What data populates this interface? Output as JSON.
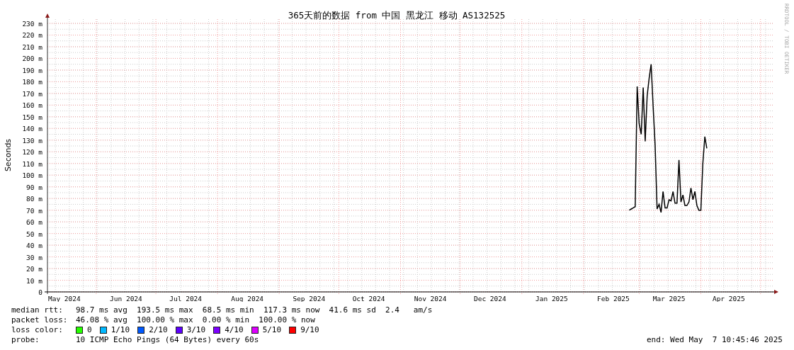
{
  "chart": {
    "title": "365天前的数据 from 中国 黑龙江 移动 AS132525",
    "credit": "RRDTOOL / TOBI OETIKER",
    "chart_data": {
      "type": "line",
      "grid": true,
      "ylabel": "Seconds",
      "ylim": [
        0,
        230
      ],
      "categories": [
        null,
        null,
        null,
        null,
        null,
        null,
        null,
        null,
        "May 2024",
        null,
        null,
        null,
        null,
        null,
        null,
        null,
        null,
        null,
        null,
        null,
        null,
        null,
        null,
        null,
        null,
        null,
        null,
        null,
        null,
        null,
        null,
        null,
        null,
        null,
        null,
        null,
        null,
        null,
        null,
        "Jun 2024",
        null,
        null,
        null,
        null,
        null,
        null,
        null,
        null,
        null,
        null,
        null,
        null,
        null,
        null,
        null,
        null,
        null,
        null,
        null,
        null,
        null,
        null,
        null,
        null,
        null,
        null,
        null,
        null,
        null,
        "Jul 2024",
        null,
        null,
        null,
        null,
        null,
        null,
        null,
        null,
        null,
        null,
        null,
        null,
        null,
        null,
        null,
        null,
        null,
        null,
        null,
        null,
        null,
        null,
        null,
        null,
        null,
        null,
        null,
        null,
        null,
        null,
        "Aug 2024",
        null,
        null,
        null,
        null,
        null,
        null,
        null,
        null,
        null,
        null,
        null,
        null,
        null,
        null,
        null,
        null,
        null,
        null,
        null,
        null,
        null,
        null,
        null,
        null,
        null,
        null,
        null,
        null,
        null,
        null,
        "Sep 2024",
        null,
        null,
        null,
        null,
        null,
        null,
        null,
        null,
        null,
        null,
        null,
        null,
        null,
        null,
        null,
        null,
        null,
        null,
        null,
        null,
        null,
        null,
        null,
        null,
        null,
        null,
        null,
        null,
        null,
        "Oct 2024",
        null,
        null,
        null,
        null,
        null,
        null,
        null,
        null,
        null,
        null,
        null,
        null,
        null,
        null,
        null,
        null,
        null,
        null,
        null,
        null,
        null,
        null,
        null,
        null,
        null,
        null,
        null,
        null,
        null,
        null,
        "Nov 2024",
        null,
        null,
        null,
        null,
        null,
        null,
        null,
        null,
        null,
        null,
        null,
        null,
        null,
        null,
        null,
        null,
        null,
        null,
        null,
        null,
        null,
        null,
        null,
        null,
        null,
        null,
        null,
        null,
        null,
        "Dec 2024",
        null,
        null,
        null,
        null,
        null,
        null,
        null,
        null,
        null,
        null,
        null,
        null,
        null,
        null,
        null,
        null,
        null,
        null,
        null,
        null,
        null,
        null,
        null,
        null,
        null,
        null,
        null,
        null,
        null,
        null,
        "Jan 2025",
        null,
        null,
        null,
        null,
        null,
        null,
        null,
        null,
        null,
        null,
        null,
        null,
        null,
        null,
        null,
        null,
        null,
        null,
        null,
        null,
        null,
        null,
        null,
        null,
        null,
        null,
        null,
        null,
        null,
        null,
        "Feb 2025",
        null,
        null,
        null,
        null,
        null,
        null,
        null,
        null,
        null,
        null,
        null,
        null,
        null,
        null,
        null,
        null,
        null,
        null,
        null,
        null,
        null,
        null,
        null,
        null,
        null,
        null,
        null,
        "Mar 2025",
        null,
        null,
        null,
        null,
        null,
        null,
        null,
        null,
        null,
        null,
        null,
        null,
        null,
        null,
        null,
        null,
        null,
        null,
        null,
        null,
        null,
        null,
        null,
        null,
        null,
        null,
        null,
        null,
        null,
        "Apr 2025",
        null,
        null,
        null,
        null,
        null,
        null,
        null,
        null,
        null,
        null,
        null,
        null,
        null,
        null,
        null,
        null,
        null,
        null,
        null,
        null,
        null,
        null
      ],
      "series": [
        {
          "color": "#000000",
          "values": [
            null,
            null,
            null,
            null,
            null,
            null,
            null,
            null,
            null,
            null,
            null,
            null,
            null,
            null,
            null,
            null,
            null,
            null,
            null,
            null,
            null,
            null,
            null,
            null,
            null,
            null,
            null,
            null,
            null,
            null,
            null,
            null,
            null,
            null,
            null,
            null,
            null,
            null,
            null,
            null,
            null,
            null,
            null,
            null,
            null,
            null,
            null,
            null,
            null,
            null,
            null,
            null,
            null,
            null,
            null,
            null,
            null,
            null,
            null,
            null,
            null,
            null,
            null,
            null,
            null,
            null,
            null,
            null,
            null,
            null,
            null,
            null,
            null,
            null,
            null,
            null,
            null,
            null,
            null,
            null,
            null,
            null,
            null,
            null,
            null,
            null,
            null,
            null,
            null,
            null,
            null,
            null,
            null,
            null,
            null,
            null,
            null,
            null,
            null,
            null,
            null,
            null,
            null,
            null,
            null,
            null,
            null,
            null,
            null,
            null,
            null,
            null,
            null,
            null,
            null,
            null,
            null,
            null,
            null,
            null,
            null,
            null,
            null,
            null,
            null,
            null,
            null,
            null,
            null,
            null,
            null,
            null,
            null,
            null,
            null,
            null,
            null,
            null,
            null,
            null,
            null,
            null,
            null,
            null,
            null,
            null,
            null,
            null,
            null,
            null,
            null,
            null,
            null,
            null,
            null,
            null,
            null,
            null,
            null,
            null,
            null,
            null,
            null,
            null,
            null,
            null,
            null,
            null,
            null,
            null,
            null,
            null,
            null,
            null,
            null,
            null,
            null,
            null,
            null,
            null,
            null,
            null,
            null,
            null,
            null,
            null,
            null,
            null,
            null,
            null,
            null,
            null,
            null,
            null,
            null,
            null,
            null,
            null,
            null,
            null,
            null,
            null,
            null,
            null,
            null,
            null,
            null,
            null,
            null,
            null,
            null,
            null,
            null,
            null,
            null,
            null,
            null,
            null,
            null,
            null,
            null,
            null,
            null,
            null,
            null,
            null,
            null,
            null,
            null,
            null,
            null,
            null,
            null,
            null,
            null,
            null,
            null,
            null,
            null,
            null,
            null,
            null,
            null,
            null,
            null,
            null,
            null,
            null,
            null,
            null,
            null,
            null,
            null,
            null,
            null,
            null,
            null,
            null,
            null,
            null,
            null,
            null,
            null,
            null,
            null,
            null,
            null,
            null,
            null,
            null,
            null,
            null,
            null,
            null,
            null,
            null,
            null,
            null,
            null,
            null,
            null,
            null,
            null,
            null,
            null,
            null,
            null,
            null,
            null,
            null,
            null,
            null,
            70,
            71,
            72,
            73,
            176,
            144,
            135,
            175,
            129,
            168,
            183,
            195,
            159,
            126,
            71,
            75,
            68,
            86,
            72,
            72,
            79,
            78,
            86,
            76,
            76,
            113,
            77,
            83,
            74,
            74,
            77,
            89,
            79,
            86,
            74,
            70,
            70,
            110,
            133,
            123,
            null,
            null,
            null,
            null,
            null,
            null,
            null,
            null,
            null,
            null,
            null,
            null,
            null,
            null,
            null,
            null,
            null,
            null,
            null,
            null,
            null,
            null,
            null,
            null,
            null,
            null,
            null,
            null,
            null,
            null,
            null,
            null,
            null
          ]
        }
      ],
      "yticks": [
        {
          "value": 0,
          "label": "0"
        },
        {
          "value": 10,
          "label": "10 m"
        },
        {
          "value": 20,
          "label": "20 m"
        },
        {
          "value": 30,
          "label": "30 m"
        },
        {
          "value": 40,
          "label": "40 m"
        },
        {
          "value": 50,
          "label": "50 m"
        },
        {
          "value": 60,
          "label": "60 m"
        },
        {
          "value": 70,
          "label": "70 m"
        },
        {
          "value": 80,
          "label": "80 m"
        },
        {
          "value": 90,
          "label": "90 m"
        },
        {
          "value": 100,
          "label": "100 m"
        },
        {
          "value": 110,
          "label": "110 m"
        },
        {
          "value": 120,
          "label": "120 m"
        },
        {
          "value": 130,
          "label": "130 m"
        },
        {
          "value": 140,
          "label": "140 m"
        },
        {
          "value": 150,
          "label": "150 m"
        },
        {
          "value": 160,
          "label": "160 m"
        },
        {
          "value": 170,
          "label": "170 m"
        },
        {
          "value": 180,
          "label": "180 m"
        },
        {
          "value": 190,
          "label": "190 m"
        },
        {
          "value": 200,
          "label": "200 m"
        },
        {
          "value": 210,
          "label": "210 m"
        },
        {
          "value": 220,
          "label": "220 m"
        },
        {
          "value": 230,
          "label": "230 m"
        }
      ]
    }
  },
  "stats": [
    {
      "label": "median rtt:",
      "text": "98.7 ms avg  193.5 ms max  68.5 ms min  117.3 ms now  41.6 ms sd  2.4   am/s"
    },
    {
      "label": "packet loss:",
      "text": "46.08 % avg  100.00 % max  0.00 % min  100.00 % now"
    }
  ],
  "loss_colors": {
    "label": "loss color:",
    "items": [
      {
        "label": "0",
        "color": "#26ff00"
      },
      {
        "label": "1/10",
        "color": "#00b8ff"
      },
      {
        "label": "2/10",
        "color": "#0059ff"
      },
      {
        "label": "3/10",
        "color": "#5e00ff"
      },
      {
        "label": "4/10",
        "color": "#7e00ff"
      },
      {
        "label": "5/10",
        "color": "#dd00ff"
      },
      {
        "label": "9/10",
        "color": "#ff0000"
      }
    ]
  },
  "probe": {
    "label": "probe:",
    "text": "10 ICMP Echo Pings (64 Bytes) every 60s"
  },
  "end": "end: Wed May  7 10:45:46 2025"
}
